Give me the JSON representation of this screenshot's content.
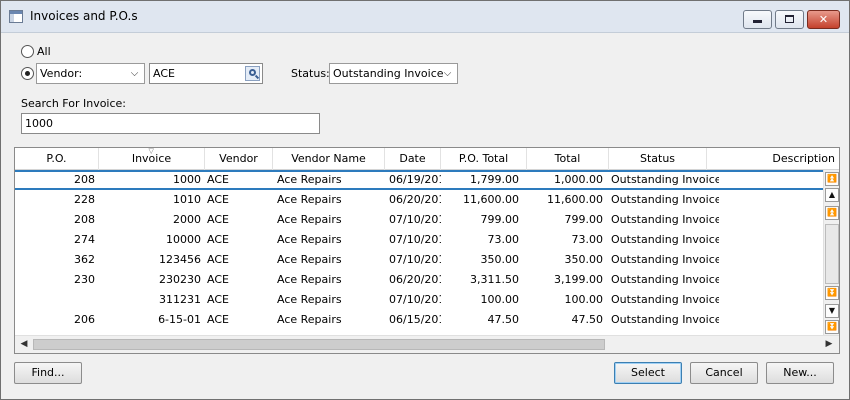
{
  "window": {
    "title": "Invoices and P.O.s"
  },
  "filters": {
    "all_label": "All",
    "vendor_mode": "Vendor:",
    "vendor_value": "ACE",
    "status_label": "Status:",
    "status_value": "Outstanding Invoice",
    "search_label": "Search For Invoice:",
    "search_value": "1000"
  },
  "grid": {
    "columns": [
      "P.O.",
      "Invoice",
      "Vendor",
      "Vendor Name",
      "Date",
      "P.O. Total",
      "Total",
      "Status",
      "Description"
    ],
    "rows": [
      {
        "po": "208",
        "invoice": "1000",
        "vendor": "ACE",
        "vendor_name": "Ace Repairs",
        "date": "06/19/201",
        "po_total": "1,799.00",
        "total": "1,000.00",
        "status": "Outstanding Invoice",
        "description": ""
      },
      {
        "po": "228",
        "invoice": "1010",
        "vendor": "ACE",
        "vendor_name": "Ace Repairs",
        "date": "06/20/201",
        "po_total": "11,600.00",
        "total": "11,600.00",
        "status": "Outstanding Invoice",
        "description": ""
      },
      {
        "po": "208",
        "invoice": "2000",
        "vendor": "ACE",
        "vendor_name": "Ace Repairs",
        "date": "07/10/201",
        "po_total": "799.00",
        "total": "799.00",
        "status": "Outstanding Invoice",
        "description": ""
      },
      {
        "po": "274",
        "invoice": "10000",
        "vendor": "ACE",
        "vendor_name": "Ace Repairs",
        "date": "07/10/201",
        "po_total": "73.00",
        "total": "73.00",
        "status": "Outstanding Invoice",
        "description": ""
      },
      {
        "po": "362",
        "invoice": "123456",
        "vendor": "ACE",
        "vendor_name": "Ace Repairs",
        "date": "07/10/201",
        "po_total": "350.00",
        "total": "350.00",
        "status": "Outstanding Invoice",
        "description": ""
      },
      {
        "po": "230",
        "invoice": "230230",
        "vendor": "ACE",
        "vendor_name": "Ace Repairs",
        "date": "06/20/201",
        "po_total": "3,311.50",
        "total": "3,199.00",
        "status": "Outstanding Invoice",
        "description": ""
      },
      {
        "po": "",
        "invoice": "311231",
        "vendor": "ACE",
        "vendor_name": "Ace Repairs",
        "date": "07/10/201",
        "po_total": "100.00",
        "total": "100.00",
        "status": "Outstanding Invoice",
        "description": ""
      },
      {
        "po": "206",
        "invoice": "6-15-01",
        "vendor": "ACE",
        "vendor_name": "Ace Repairs",
        "date": "06/15/201",
        "po_total": "47.50",
        "total": "47.50",
        "status": "Outstanding Invoice",
        "description": ""
      }
    ]
  },
  "buttons": {
    "find": "Find...",
    "select": "Select",
    "cancel": "Cancel",
    "new": "New..."
  },
  "colors": {
    "selection_border": "#2d7bbd",
    "close_button": "#c4412c"
  }
}
